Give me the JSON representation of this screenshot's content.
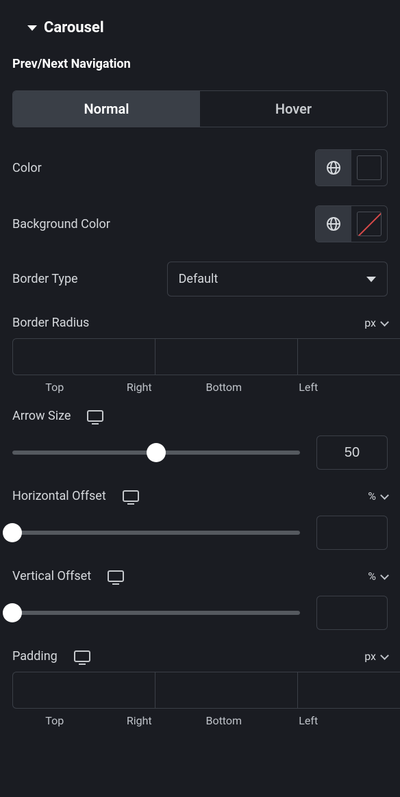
{
  "section": {
    "title": "Carousel"
  },
  "nav": {
    "heading": "Prev/Next Navigation",
    "tabs": {
      "normal": "Normal",
      "hover": "Hover"
    },
    "color_label": "Color",
    "bg_label": "Background Color",
    "border_type": {
      "label": "Border Type",
      "value": "Default"
    },
    "border_radius": {
      "label": "Border Radius",
      "unit": "px",
      "sides": {
        "top": "Top",
        "right": "Right",
        "bottom": "Bottom",
        "left": "Left"
      }
    },
    "arrow_size": {
      "label": "Arrow Size",
      "value": "50",
      "percent": 50
    },
    "h_offset": {
      "label": "Horizontal Offset",
      "unit": "%",
      "value": "",
      "percent": 0
    },
    "v_offset": {
      "label": "Vertical Offset",
      "unit": "%",
      "value": "",
      "percent": 0
    },
    "padding": {
      "label": "Padding",
      "unit": "px",
      "sides": {
        "top": "Top",
        "right": "Right",
        "bottom": "Bottom",
        "left": "Left"
      }
    }
  }
}
